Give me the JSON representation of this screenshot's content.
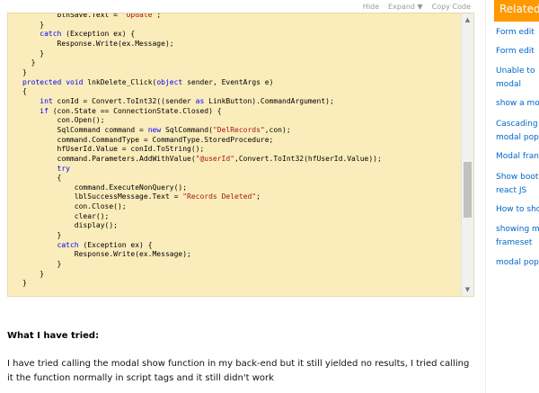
{
  "code_toolbar": {
    "hide": "Hide",
    "expand": "Expand ▼",
    "copy": "Copy Code"
  },
  "code_lines": [
    "        btnSave.Text = \"Update\";",
    "    }",
    "    catch (Exception ex) {",
    "        Response.Write(ex.Message);",
    "    }",
    "  }",
    "}",
    "protected void lnkDelete_Click(object sender, EventArgs e)",
    "{",
    "    int conId = Convert.ToInt32((sender as LinkButton).CommandArgument);",
    "    if (con.State == ConnectionState.Closed) {",
    "        con.Open();",
    "        SqlCommand command = new SqlCommand(\"DelRecords\",con);",
    "        command.CommandType = CommandType.StoredProcedure;",
    "        hfUserId.Value = conId.ToString();",
    "        command.Parameters.AddWithValue(\"@userId\",Convert.ToInt32(hfUserId.Value));",
    "        try",
    "        {",
    "            command.ExecuteNonQuery();",
    "            lblSuccessMessage.Text = \"Records Deleted\";",
    "            con.Close();",
    "            clear();",
    "            display();",
    "        }",
    "        catch (Exception ex) {",
    "            Response.Write(ex.Message);",
    "        }",
    "    }",
    "}"
  ],
  "tried": {
    "heading": "What I have tried:",
    "text": "I have tried calling the modal show function in my back-end but it still yielded no results, I tried calling it the function normally in script tags and it still didn't work"
  },
  "sidebar": {
    "header": "Related",
    "links": [
      "Form edit",
      "Form edit",
      "Unable to\nmodal",
      "show a mo",
      "Cascading\nmodal pop",
      "Modal fran",
      "Show boot\nreact JS",
      "How to sho",
      "showing m\nframeset",
      "modal pop"
    ]
  },
  "colors": {
    "code_bg": "#fbedbb",
    "keyword": "#0000ff",
    "string": "#a31515",
    "link": "#0066cc",
    "accent": "#ff9900"
  }
}
